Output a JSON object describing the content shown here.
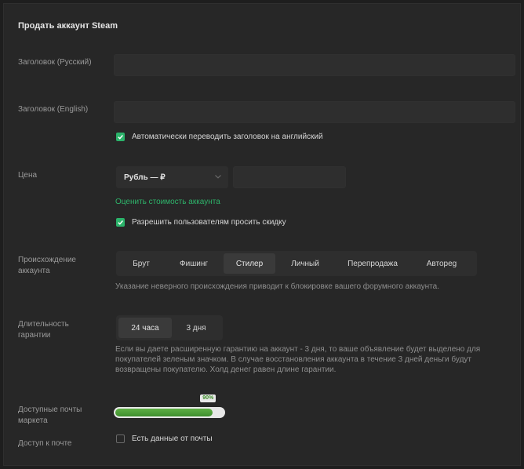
{
  "form": {
    "title": "Продать аккаунт Steam",
    "title_ru_label": "Заголовок (Русский)",
    "title_ru_value": "",
    "title_en_label": "Заголовок (English)",
    "title_en_value": "",
    "auto_translate_label": "Автоматически переводить заголовок на английский",
    "auto_translate_checked": true,
    "price_label": "Цена",
    "currency_selected": "Рубль — ₽",
    "price_value": "",
    "estimate_link": "Оценить стоимость аккаунта",
    "allow_discount_label": "Разрешить пользователям просить скидку",
    "allow_discount_checked": true,
    "origin_label": "Происхождение аккаунта",
    "origin_options": [
      "Брут",
      "Фишинг",
      "Стилер",
      "Личный",
      "Перепродажа",
      "Автореg"
    ],
    "origin_selected": "Стилер",
    "origin_hint": "Указание неверного происхождения приводит к блокировке вашего форумного аккаунта.",
    "guarantee_label": "Длительность гарантии",
    "guarantee_options": [
      "24 часа",
      "3 дня"
    ],
    "guarantee_selected": "24 часа",
    "guarantee_hint": "Если вы даете расширенную гарантию на аккаунт - 3 дня, то ваше объявление будет выделено для покупателей зеленым значком. В случае восстановления аккаунта в течение 3 дней деньги будут возвращены покупателю. Холд денег равен длине гарантии.",
    "mail_label": "Доступные почты маркета",
    "mail_percent": 90,
    "mail_percent_text": "90%",
    "mail_access_label": "Доступ к почте",
    "mail_data_label": "Есть данные от почты",
    "mail_data_checked": false
  },
  "colors": {
    "accent": "#2bb36a",
    "background": "#272727",
    "bar_fill": "#4f9f3a"
  }
}
